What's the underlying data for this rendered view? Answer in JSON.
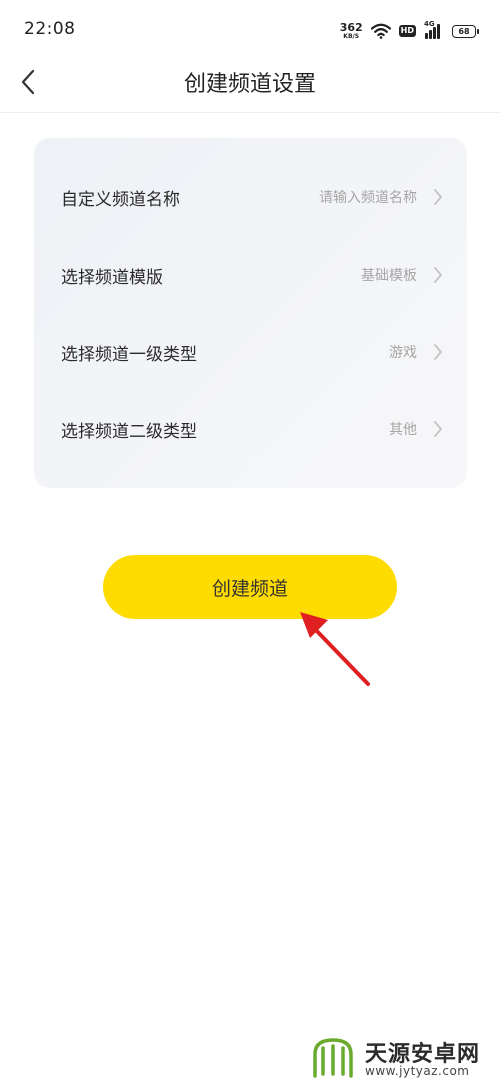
{
  "status_bar": {
    "time": "22:08",
    "net_speed_value": "362",
    "net_speed_unit": "KB/S",
    "hd_label": "HD",
    "network_label": "4G",
    "battery": "68"
  },
  "header": {
    "title": "创建频道设置",
    "back_icon": "chevron-left-icon"
  },
  "settings": {
    "rows": [
      {
        "label": "自定义频道名称",
        "value": "请输入频道名称"
      },
      {
        "label": "选择频道模版",
        "value": "基础模板"
      },
      {
        "label": "选择频道一级类型",
        "value": "游戏"
      },
      {
        "label": "选择频道二级类型",
        "value": "其他"
      }
    ]
  },
  "create_button": {
    "label": "创建频道",
    "color": "#ffdc00"
  },
  "annotation": {
    "color": "#e02020"
  },
  "watermark": {
    "text": "天源安卓网",
    "url": "www.jytyaz.com"
  }
}
